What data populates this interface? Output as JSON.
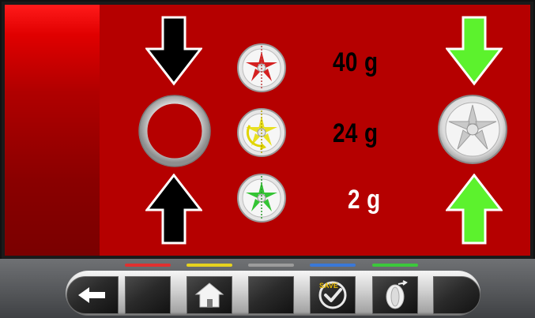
{
  "weights": {
    "top": "40 g",
    "middle": "24 g",
    "bottom": "2 g"
  },
  "colors": {
    "background_red": "#b50000",
    "arrow_black": "#000000",
    "arrow_green": "#5cf22d",
    "bar_red": "#e03030",
    "bar_yellow": "#e6d21e",
    "bar_gray": "#9c9c9c",
    "bar_blue": "#3a78d8",
    "bar_green": "#3cc83c"
  },
  "icons": {
    "save_badge": "SAVE"
  },
  "toolbar": {
    "buttons": [
      "back",
      "blank-1",
      "home",
      "blank-2",
      "save",
      "tire-measure",
      "blank-3"
    ]
  }
}
